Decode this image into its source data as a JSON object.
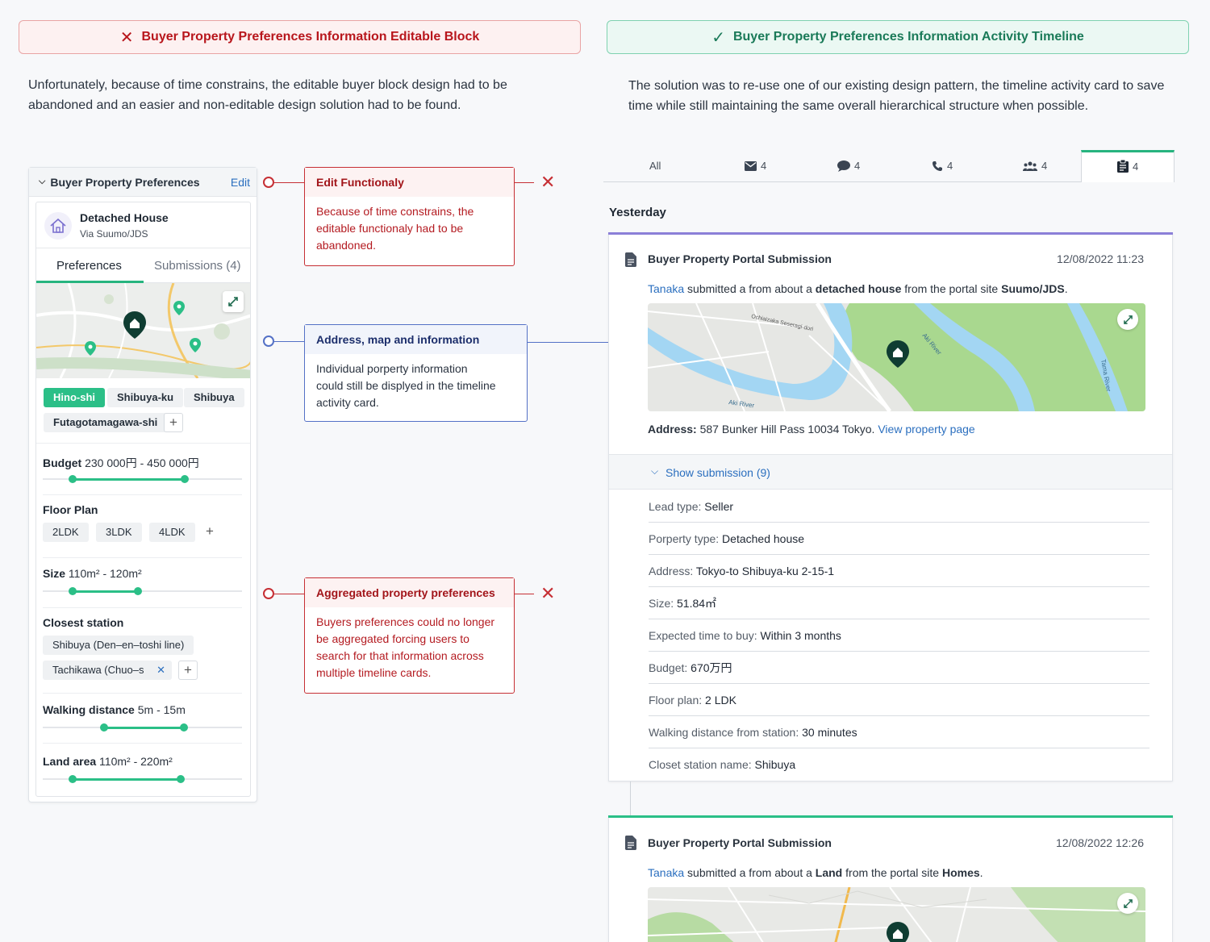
{
  "left_header": "Buyer Property Preferences Information Editable Block",
  "right_header": "Buyer Property Preferences Information Activity Timeline",
  "left_intro": [
    "Unfortunately, because of time constrains, the editable buyer block design had to be",
    "abandoned and an easier and non-editable design solution had to be found."
  ],
  "right_intro": [
    "The solution was to re-use one of our existing design pattern, the timeline activity card to save",
    "time while still maintaining the same overall hierarchical structure when possible."
  ],
  "panel": {
    "title": "Buyer Property Preferences",
    "edit_label": "Edit",
    "property_type": "Detached House",
    "via": "Via Suumo/JDS",
    "tabs": [
      "Preferences",
      "Submissions (4)"
    ],
    "areas": [
      "Hino-shi",
      "Shibuya-ku",
      "Shibuya",
      "Futagotamagawa-shi"
    ],
    "budget_label": "Budget",
    "budget_value": "230 000円 - 450 000円",
    "floor_label": "Floor Plan",
    "floor_plans": [
      "2LDK",
      "3LDK",
      "4LDK"
    ],
    "size_label": "Size",
    "size_value": "110m² - 120m²",
    "station_label": "Closest station",
    "stations": [
      "Shibuya (Den–en–toshi line)",
      "Tachikawa (Chuo–s"
    ],
    "walk_label": "Walking distance",
    "walk_value": "5m - 15m",
    "land_label": "Land area",
    "land_value": "110m² - 220m²"
  },
  "callouts": [
    {
      "title": "Edit Functionaly",
      "body": [
        "Because of time constrains, the",
        "editable functionaly had to be",
        "abandoned."
      ]
    },
    {
      "title": "Address, map and information",
      "body": [
        "Individual porperty information",
        "could still be displyed in the timeline",
        "activity card."
      ]
    },
    {
      "title": "Aggregated property preferences",
      "body": [
        "Buyers preferences could no longer",
        "be aggregated forcing users to",
        "search for that information across",
        "multiple timeline cards."
      ]
    }
  ],
  "timeline_tabs": [
    {
      "label": "All",
      "icon": "all"
    },
    {
      "label": "4",
      "icon": "mail-icon"
    },
    {
      "label": "4",
      "icon": "chat-icon"
    },
    {
      "label": "4",
      "icon": "phone-icon"
    },
    {
      "label": "4",
      "icon": "people-icon"
    },
    {
      "label": "4",
      "icon": "clipboard-icon"
    }
  ],
  "day_label": "Yesterday",
  "card1": {
    "title": "Buyer Property Portal Submission",
    "date": "12/08/2022  11:23",
    "user": "Tanaka",
    "s1": " submitted a from about a ",
    "type": "detached house",
    "s2": " from the portal site ",
    "portal": "Suumo/JDS",
    "s3": ".",
    "map_labels": [
      "Ochiaizaka Seseragi-dori",
      "Aki River",
      "Aki River",
      "Tama River"
    ],
    "address_label": "Address:",
    "address_value": " 587 Bunker Hill Pass 10034 Tokyo. ",
    "view_link": "View property page",
    "show_submission": "Show submission (9)",
    "rows": [
      {
        "k": "Lead type:  ",
        "v": "Seller"
      },
      {
        "k": "Porperty type:  ",
        "v": "Detached house"
      },
      {
        "k": "Address:  ",
        "v": "Tokyo-to Shibuya-ku 2-15-1"
      },
      {
        "k": "Size:  ",
        "v": "51.84㎡"
      },
      {
        "k": "Expected time to buy: ",
        "v": "Within 3 months"
      },
      {
        "k": "Budget: ",
        "v": "670万円"
      },
      {
        "k": "Floor plan:   ",
        "v": "2 LDK"
      },
      {
        "k": "Walking distance from station:  ",
        "v": "30 minutes"
      },
      {
        "k": "Closet station name:  ",
        "v": "Shibuya"
      }
    ]
  },
  "card2": {
    "title": "Buyer Property Portal Submission",
    "date": "12/08/2022  12:26",
    "user": "Tanaka",
    "s1": " submitted a from about a ",
    "type": "Land",
    "s2": " from the portal site ",
    "portal": "Homes",
    "s3": "."
  },
  "colors": {
    "red": "#c62f34",
    "green": "#2bbf87",
    "blue": "#5471c6",
    "purple": "#8b7fd8"
  }
}
